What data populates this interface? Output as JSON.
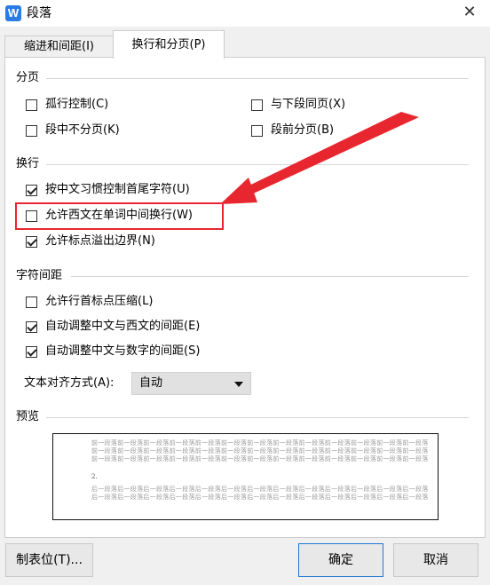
{
  "window": {
    "app_icon": "W",
    "title": "段落",
    "close_icon": "close-icon"
  },
  "tabs": [
    {
      "label": "缩进和间距(I)",
      "active": false
    },
    {
      "label": "换行和分页(P)",
      "active": true
    }
  ],
  "sections": {
    "pagination": {
      "title": "分页",
      "options": [
        {
          "label": "孤行控制(C)",
          "checked": false
        },
        {
          "label": "与下段同页(X)",
          "checked": false
        },
        {
          "label": "段中不分页(K)",
          "checked": false
        },
        {
          "label": "段前分页(B)",
          "checked": false
        }
      ]
    },
    "line_break": {
      "title": "换行",
      "options": [
        {
          "label": "按中文习惯控制首尾字符(U)",
          "checked": true
        },
        {
          "label": "允许西文在单词中间换行(W)",
          "checked": false
        },
        {
          "label": "允许标点溢出边界(N)",
          "checked": true
        }
      ]
    },
    "char_spacing": {
      "title": "字符间距",
      "options": [
        {
          "label": "允许行首标点压缩(L)",
          "checked": false
        },
        {
          "label": "自动调整中文与西文的间距(E)",
          "checked": true
        },
        {
          "label": "自动调整中文与数字的间距(S)",
          "checked": true
        }
      ],
      "align_label": "文本对齐方式(A):",
      "align_value": "自动"
    },
    "preview": {
      "title": "预览",
      "prev_line": "前一段落前一段落前一段落前一段落前一段落前一段落前一段落前一段落前一段落前一段落前一段落前一段落前一段落",
      "sample_number": "2.",
      "next_line": "后一段落后一段落后一段落后一段落后一段落后一段落后一段落后一段落后一段落后一段落后一段落后一段落后一段落"
    }
  },
  "buttons": {
    "tabs": "制表位(T)...",
    "ok": "确定",
    "cancel": "取消"
  },
  "colors": {
    "highlight": "#e8262f",
    "accent": "#1f78d6"
  }
}
